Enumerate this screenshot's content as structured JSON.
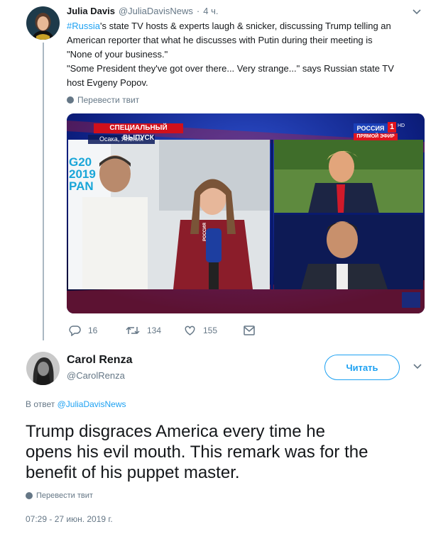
{
  "tweet1": {
    "author_name": "Julia Davis",
    "author_handle": "@JuliaDavisNews",
    "dot": "·",
    "time": "4 ч.",
    "text_hashtag": "#Russia",
    "text_line1_rest": "'s state TV hosts & experts laugh & snicker, discussing Trump telling an",
    "text_line2": "American reporter that what he discusses with Putin during their meeting is",
    "text_line3": "\"None of your business.\"",
    "text_line4": "\"Some President they've got over there... Very strange...\" says Russian state TV",
    "text_line5": "host Evgeny Popov.",
    "translate_label": "Перевести твит",
    "media": {
      "banner": "СПЕЦИАЛЬНЫЙ ВЫПУСК",
      "location": "Осака, Япония",
      "channel": "РОССИЯ",
      "channel_num": "1",
      "channel_hd": "HD",
      "live": "ПРЯМОЙ ЭФИР",
      "backdrop_text": [
        "G20",
        "2019",
        "PAN"
      ],
      "mic_label": "РОССИЯ"
    },
    "replies": "16",
    "retweets": "134",
    "likes": "155"
  },
  "tweet2": {
    "author_name": "Carol Renza",
    "author_handle": "@CarolRenza",
    "follow_label": "Читать",
    "reply_prefix": "В ответ",
    "reply_to": "@JuliaDavisNews",
    "text_line1": "Trump disgraces America every time he",
    "text_line2": "opens his evil mouth.  This remark was for the",
    "text_line3": "benefit of his puppet master.",
    "translate_label": "Перевести твит",
    "timestamp": "07:29 - 27 июн. 2019 г."
  },
  "colors": {
    "accent": "#1da1f2",
    "muted": "#657786",
    "banner_red": "#d0101b",
    "studio_blue": "#0a1a6e"
  }
}
